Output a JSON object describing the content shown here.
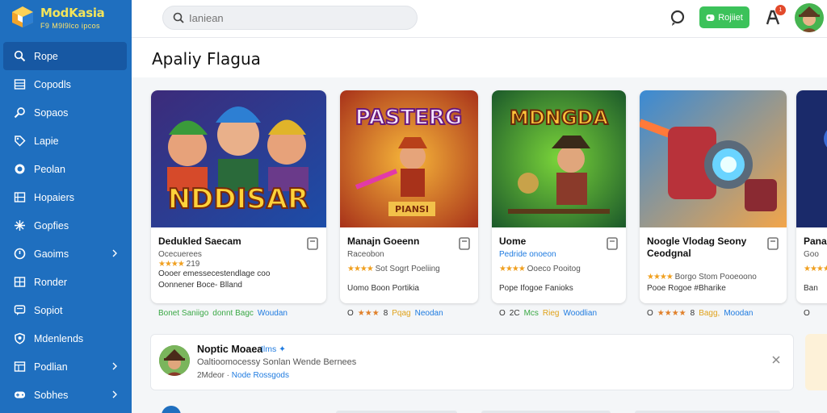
{
  "app": {
    "title": "ModKasia",
    "subtitle": "F9 M9l9lco ipcos"
  },
  "sidebar": {
    "items": [
      {
        "label": "Rope",
        "icon": "search-icon",
        "active": true
      },
      {
        "label": "Copodls",
        "icon": "grid-icon"
      },
      {
        "label": "Sopaos",
        "icon": "magnifier-icon"
      },
      {
        "label": "Lapie",
        "icon": "tag-icon"
      },
      {
        "label": "Peolan",
        "icon": "target-icon"
      },
      {
        "label": "Hopaiers",
        "icon": "list-icon"
      },
      {
        "label": "Gopfies",
        "icon": "sparkle-icon"
      },
      {
        "label": "Gaoims",
        "icon": "clock-icon",
        "chevron": true
      },
      {
        "label": "Ronder",
        "icon": "box-icon"
      },
      {
        "label": "Sopiot",
        "icon": "chat-icon"
      },
      {
        "label": "Mdenlends",
        "icon": "shield-icon"
      },
      {
        "label": "Podlian",
        "icon": "table-icon",
        "chevron": true
      },
      {
        "label": "Sobhes",
        "icon": "gamepad-icon",
        "chevron": true
      }
    ]
  },
  "header": {
    "search_placeholder": "Ianiean",
    "green_button": "Rojiiet",
    "badge_count": "1"
  },
  "page": {
    "title": "Apaliy Flagua"
  },
  "cards": [
    {
      "art_title": "NDDISAR",
      "name": "Dedukled Saecam",
      "dev": "Ocecuerees",
      "rating_text": "219",
      "line2": "Oooer emessecestendlage coo",
      "line3": "Oonnener Boce- Blland",
      "footer": [
        {
          "text": "Bonet Saniigo",
          "color": "#3aa845"
        },
        {
          "text": "donnt Bagc",
          "color": "#3aa845"
        },
        {
          "text": "Woudan",
          "color": "#1f7be0"
        }
      ]
    },
    {
      "art_title": "PASTERG",
      "art_sub": "PIANSI",
      "name": "Manajn Goeenn",
      "dev": "Raceobon",
      "rating_text": "Sot Sogrt Poeliing",
      "line3": "Uomo  Boon  Portikia",
      "footer": [
        {
          "text": "O",
          "color": "#333"
        },
        {
          "text": "★★★",
          "color": "#e0802a"
        },
        {
          "text": "8",
          "color": "#333"
        },
        {
          "text": "Pqag",
          "color": "#e0a21a"
        },
        {
          "text": "Neodan",
          "color": "#1f7be0"
        }
      ]
    },
    {
      "art_title": "MDNGDA",
      "name": "Uome",
      "dev": "Pedride onoeon",
      "rating_text": "Ooeco Pooitog",
      "line3": "Pope  Ifogoe   Fanioks",
      "footer": [
        {
          "text": "O",
          "color": "#333"
        },
        {
          "text": "2C",
          "color": "#333"
        },
        {
          "text": "Mcs",
          "color": "#3aa845"
        },
        {
          "text": "Rieg",
          "color": "#e0a21a"
        },
        {
          "text": "Woodlian",
          "color": "#1f7be0"
        }
      ]
    },
    {
      "art_title": "",
      "name": "Noogle Vlodag Seony Ceodgnal",
      "dev": "",
      "rating_text": "Borgo Stom Pooeoono",
      "line3": "Pooe  Rogoe  #Bharike",
      "footer": [
        {
          "text": "O",
          "color": "#333"
        },
        {
          "text": "★★★★",
          "color": "#e0802a"
        },
        {
          "text": "8",
          "color": "#333"
        },
        {
          "text": "Bagg,",
          "color": "#e0a21a"
        },
        {
          "text": "Moodan",
          "color": "#1f7be0"
        }
      ]
    },
    {
      "art_title": "",
      "name": "Pana",
      "dev": "Goo",
      "rating_text": "Oo",
      "line3": "Ban",
      "footer": [
        {
          "text": "O",
          "color": "#333"
        }
      ]
    }
  ],
  "notification": {
    "title": "Noptic Moaea",
    "tag": "Ilms ✦",
    "desc": "Oaltioomocessy Sonlan Wende Bernees",
    "meta_prefix": "2Mdeor · ",
    "meta_link": "Node Rossgods"
  },
  "colors": {
    "sidebar": "#1f6fbf",
    "accent": "#3cc25a",
    "link": "#1f7be0"
  }
}
